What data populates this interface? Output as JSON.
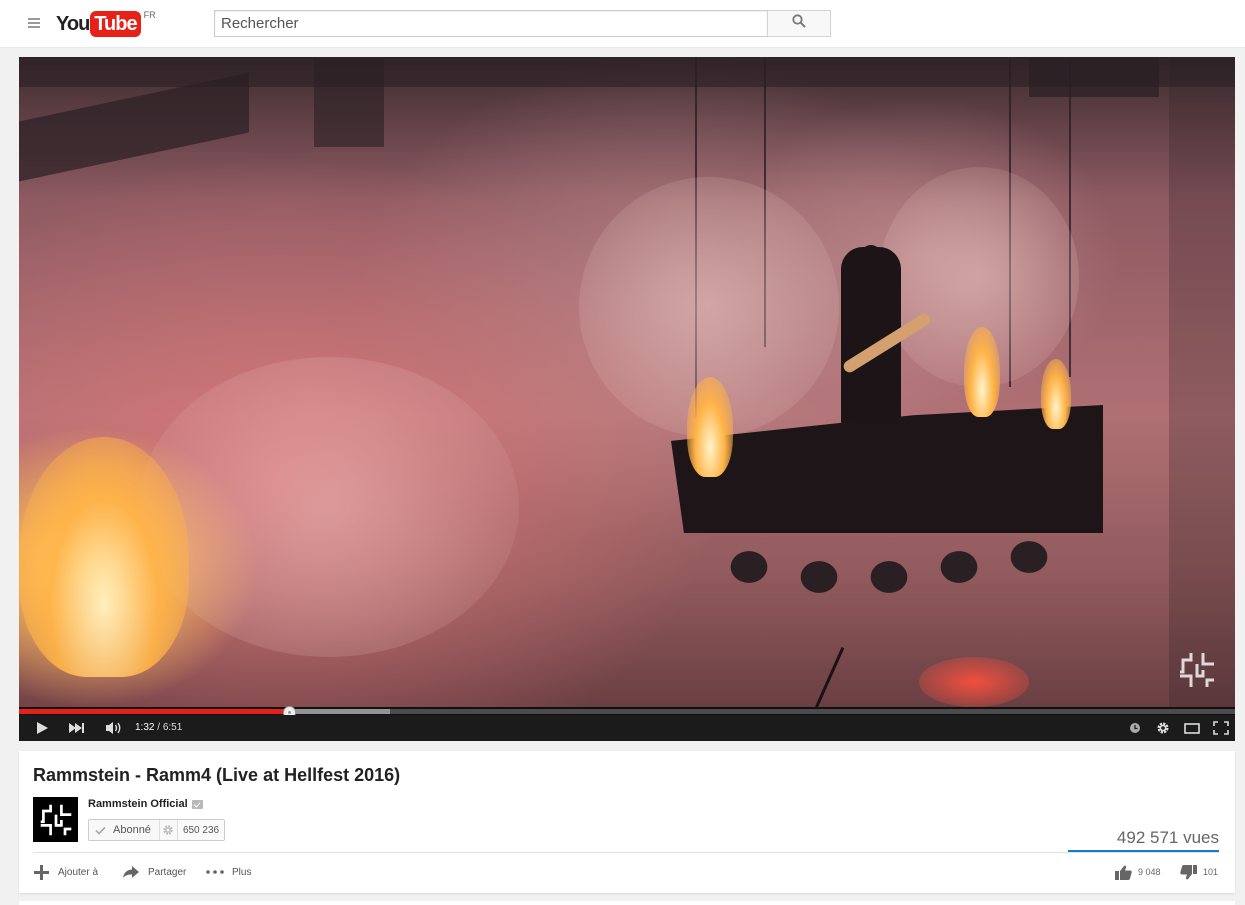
{
  "header": {
    "logo_you": "You",
    "logo_tube": "Tube",
    "country": "FR",
    "search_placeholder": "Rechercher",
    "icons": {
      "menu": "hamburger-menu-icon",
      "search": "search-icon"
    }
  },
  "player": {
    "progress": 0.222,
    "buffered": 0.305,
    "current_time": "1:32",
    "separator": " / ",
    "duration": "6:51",
    "accent_color": "#e62117",
    "icons": [
      "play-icon",
      "next-icon",
      "volume-icon",
      "watch-later-icon",
      "settings-icon",
      "theater-mode-icon",
      "fullscreen-icon"
    ]
  },
  "video": {
    "title": "Rammstein - Ramm4 (Live at Hellfest 2016)",
    "channel": "Rammstein Official",
    "subscribe_label": "Abonné",
    "subscriber_count": "650 236",
    "views": "492 571 vues",
    "actions": {
      "add": "Ajouter à",
      "share": "Partager",
      "more": "Plus"
    },
    "likes": "9 048",
    "dislikes": "101",
    "like_ratio": 0.989,
    "sentiment_color": "#167ac6"
  }
}
